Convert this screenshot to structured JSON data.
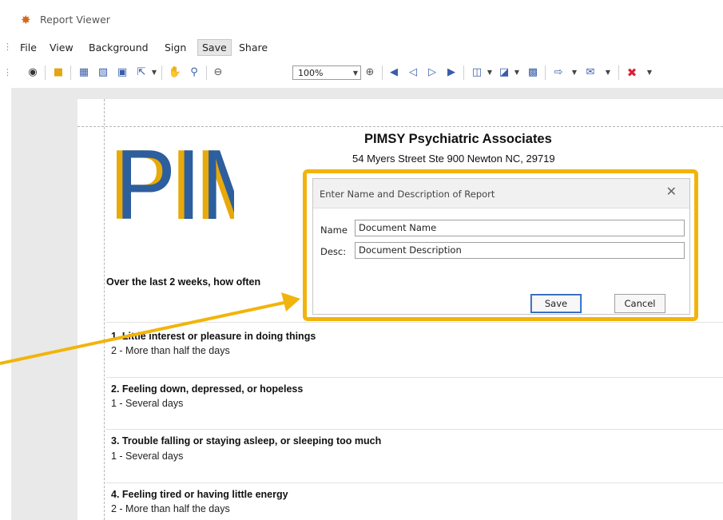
{
  "window": {
    "title": "Report Viewer",
    "app_icon": "maple-leaf-icon"
  },
  "menu": {
    "items": [
      {
        "label": "File"
      },
      {
        "label": "View"
      },
      {
        "label": "Background"
      },
      {
        "label": "Sign"
      },
      {
        "label": "Save",
        "active": true
      },
      {
        "label": "Share"
      }
    ]
  },
  "toolbar": {
    "zoom_value": "100%",
    "icons": [
      "search-binoculars-icon",
      "open-folder-icon",
      "print-icon",
      "quick-print-icon",
      "page-setup-icon",
      "scale-icon",
      "hand-tool-icon",
      "magnifier-icon",
      "zoom-out-icon",
      "zoom-in-icon",
      "first-page-icon",
      "previous-page-icon",
      "next-page-icon",
      "last-page-icon",
      "multiple-pages-icon",
      "page-color-icon",
      "watermark-icon",
      "export-icon",
      "send-email-icon",
      "close-preview-icon"
    ]
  },
  "report": {
    "logo_text": "PIMSY",
    "practice_name": "PIMSY Psychiatric Associates",
    "practice_address": "54 Myers Street Ste 900  Newton NC, 29719",
    "question_intro": "Over the last 2 weeks, how often",
    "questions": [
      {
        "title": "1.  Little interest or pleasure in doing things",
        "answer": "2 - More than half the days"
      },
      {
        "title": "2.  Feeling down, depressed, or hopeless",
        "answer": "1 - Several days"
      },
      {
        "title": "3.  Trouble falling or staying asleep, or sleeping too much",
        "answer": "1 - Several days"
      },
      {
        "title": "4.  Feeling tired or having little energy",
        "answer": "2 - More than half the days"
      }
    ]
  },
  "dialog": {
    "title": "Enter Name and Description of Report",
    "name_label": "Name",
    "name_value": "Document Name",
    "desc_label": "Desc:",
    "desc_value": "Document Description",
    "save_label": "Save",
    "cancel_label": "Cancel"
  },
  "colors": {
    "highlight": "#f2b40c",
    "toolbar_icon": "#3a5da8",
    "logo_blue": "#2d5e9e",
    "logo_gold": "#e8a90a"
  }
}
